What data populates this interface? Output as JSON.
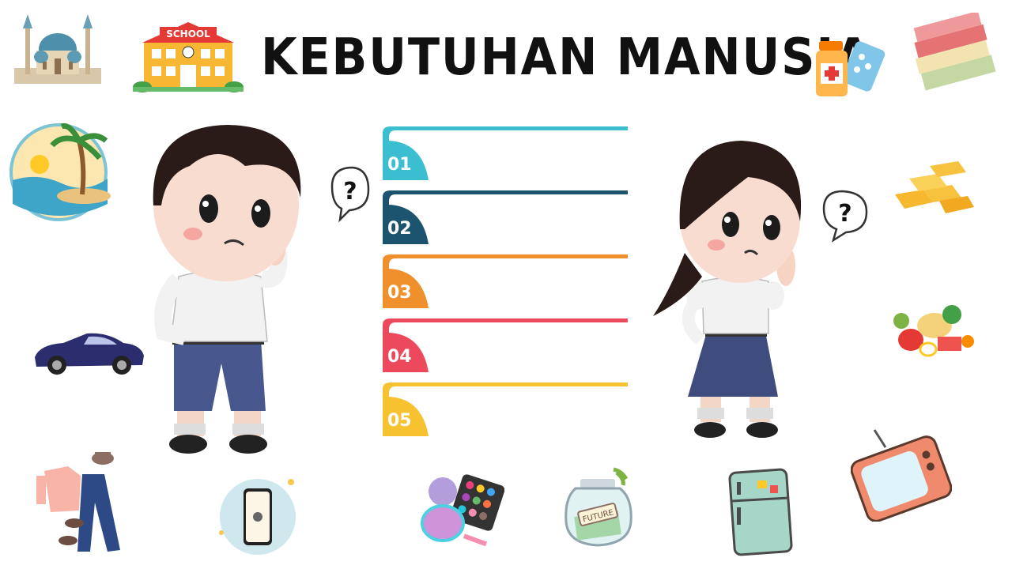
{
  "title": "KEBUTUHAN MANUSIA",
  "school_sign": "SCHOOL",
  "numbered_list": [
    {
      "number": "01",
      "color": "#3bbfd0"
    },
    {
      "number": "02",
      "color": "#1c5470"
    },
    {
      "number": "03",
      "color": "#f0902d"
    },
    {
      "number": "04",
      "color": "#ec4a5c"
    },
    {
      "number": "05",
      "color": "#f6c22f"
    }
  ],
  "question_mark": "?",
  "jar_label": "FUTURE",
  "illustrations": [
    "mosque",
    "school",
    "medicine",
    "books",
    "beach-island",
    "gold-bars",
    "sports-car",
    "food",
    "clothes",
    "smartphone",
    "makeup",
    "savings-jar",
    "refrigerator",
    "television",
    "boy-thinking",
    "girl-thinking"
  ]
}
